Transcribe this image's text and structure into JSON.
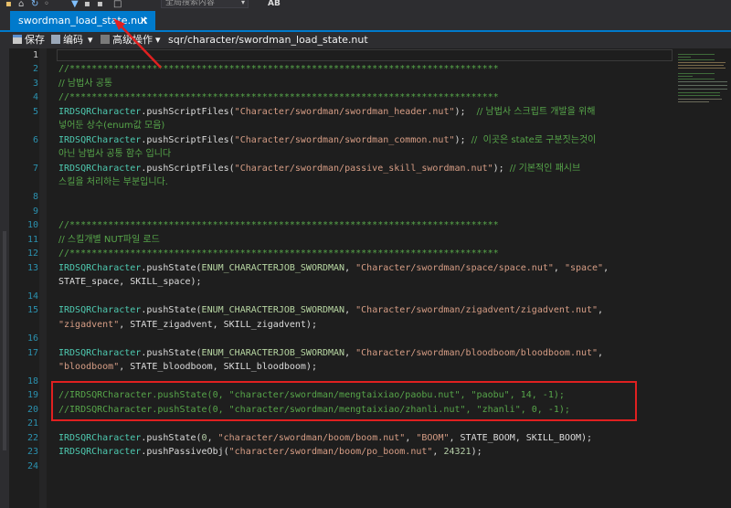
{
  "toolbar": {
    "search_placeholder": "全局搜索内容",
    "dropdown_glyph": "▾",
    "ab_label": "AB"
  },
  "tab": {
    "title": "swordman_load_state.nut",
    "close_glyph": "✕"
  },
  "editor_toolbar": {
    "save_label": "保存",
    "edit_label": "编码",
    "advanced_label": "高级操作",
    "path": "sqr/character/swordman_load_state.nut",
    "dropdown_glyph": "▾"
  },
  "code": {
    "line_numbers": [
      "1",
      "2",
      "3",
      "4",
      "5",
      "6",
      "7",
      "8",
      "9",
      "10",
      "11",
      "12",
      "13",
      "14",
      "15",
      "16",
      "17",
      "18",
      "19",
      "20",
      "21",
      "22",
      "23",
      "24"
    ],
    "lines": {
      "l2": "//******************************************************************************",
      "l3": "// 남법사 공통",
      "l4": "//******************************************************************************",
      "l5a_obj": "IRDSQRCharacter",
      "l5a_fn": ".pushScriptFiles(",
      "l5a_str": "\"Character/swordman/swordman_header.nut\"",
      "l5a_end": ");  ",
      "l5a_cmt": "// 남법사 스크립트 개발을 위해",
      "l5b_cmt": "넣어둔 상수(enum값 모음)",
      "l6a_obj": "IRDSQRCharacter",
      "l6a_fn": ".pushScriptFiles(",
      "l6a_str": "\"Character/swordman/swordman_common.nut\"",
      "l6a_end": "); ",
      "l6a_cmt": "//  이곳은 state로 구분짓는것이",
      "l6b_cmt": "아닌 남법사 공통 함수 입니다",
      "l7a_obj": "IRDSQRCharacter",
      "l7a_fn": ".pushScriptFiles(",
      "l7a_str": "\"Character/swordman/passive_skill_swordman.nut\"",
      "l7a_end": "); ",
      "l7a_cmt": "// 기본적인 패시브",
      "l7b_cmt": "스킬을 처리하는 부분입니다.",
      "l10": "//******************************************************************************",
      "l11": "// 스킬개별 NUT파일 로드",
      "l12": "//******************************************************************************",
      "l13a_obj": "IRDSQRCharacter",
      "l13a_fn": ".pushState(",
      "l13a_enum": "ENUM_CHARACTERJOB_SWORDMAN",
      "l13a_sep": ", ",
      "l13a_str1": "\"Character/swordman/space/space.nut\"",
      "l13a_sep2": ", ",
      "l13a_str2": "\"space\"",
      "l13a_end": ",",
      "l13b": "STATE_space, SKILL_space);",
      "l15a_obj": "IRDSQRCharacter",
      "l15a_fn": ".pushState(",
      "l15a_enum": "ENUM_CHARACTERJOB_SWORDMAN",
      "l15a_sep": ", ",
      "l15a_str1": "\"Character/swordman/zigadvent/zigadvent.nut\"",
      "l15a_end": ",",
      "l15b_str": "\"zigadvent\"",
      "l15b_rest": ", STATE_zigadvent, SKILL_zigadvent);",
      "l17a_obj": "IRDSQRCharacter",
      "l17a_fn": ".pushState(",
      "l17a_enum": "ENUM_CHARACTERJOB_SWORDMAN",
      "l17a_sep": ", ",
      "l17a_str1": "\"Character/swordman/bloodboom/bloodboom.nut\"",
      "l17a_end": ",",
      "l17b_str": "\"bloodboom\"",
      "l17b_rest": ", STATE_bloodboom, SKILL_bloodboom);",
      "l19": "//IRDSQRCharacter.pushState(0, \"character/swordman/mengtaixiao/paobu.nut\", \"paobu\", 14, -1);",
      "l20": "//IRDSQRCharacter.pushState(0, \"character/swordman/mengtaixiao/zhanli.nut\", \"zhanli\", 0, -1);",
      "l22_obj": "IRDSQRCharacter",
      "l22_fn": ".pushState(",
      "l22_num": "0",
      "l22_sep": ", ",
      "l22_str1": "\"character/swordman/boom/boom.nut\"",
      "l22_sep2": ", ",
      "l22_str2": "\"BOOM\"",
      "l22_rest": ", STATE_BOOM, SKILL_BOOM);",
      "l23_obj": "IRDSQRCharacter",
      "l23_fn": ".pushPassiveObj(",
      "l23_str": "\"character/swordman/boom/po_boom.nut\"",
      "l23_sep": ", ",
      "l23_num": "24321",
      "l23_end": ");"
    }
  },
  "colors": {
    "accent": "#007acc",
    "comment": "#57a64a",
    "string": "#d69d85",
    "type": "#4ec9b0",
    "highlight_box": "#e02020"
  }
}
